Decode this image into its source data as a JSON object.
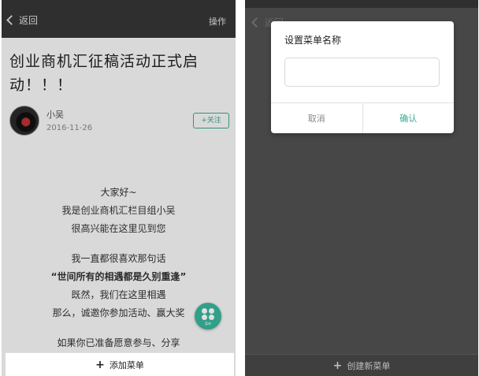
{
  "left_screen": {
    "nav": {
      "back_label": "返回",
      "action_label": "操作"
    },
    "article": {
      "title": "创业商机汇征稿活动正式启动！！！",
      "author": "小吴",
      "date": "2016-11-26",
      "follow_label": "+关注",
      "paragraphs": [
        [
          "大家好~",
          "我是创业商机汇栏目组小吴",
          "很高兴能在这里见到您"
        ],
        [
          "我一直都很喜欢那句话",
          "“世间所有的相遇都是久别重逢”",
          "既然，我们在这里相遇",
          "那么，诚邀你参加活动、赢大奖"
        ],
        [
          "如果你已准备愿意参与、分享"
        ]
      ]
    },
    "fab_label": "菜单",
    "bottom_bar": {
      "label": "添加菜单"
    }
  },
  "right_screen": {
    "nav": {
      "back_label": "返回"
    },
    "dialog": {
      "title": "设置菜单名称",
      "input_value": "",
      "input_placeholder": "",
      "cancel_label": "取消",
      "confirm_label": "确认"
    },
    "bottom_bar": {
      "label": "创建新菜单"
    }
  },
  "colors": {
    "accent": "#3aa88f",
    "nav_bar": "#363636",
    "dim_background": "#474747"
  }
}
